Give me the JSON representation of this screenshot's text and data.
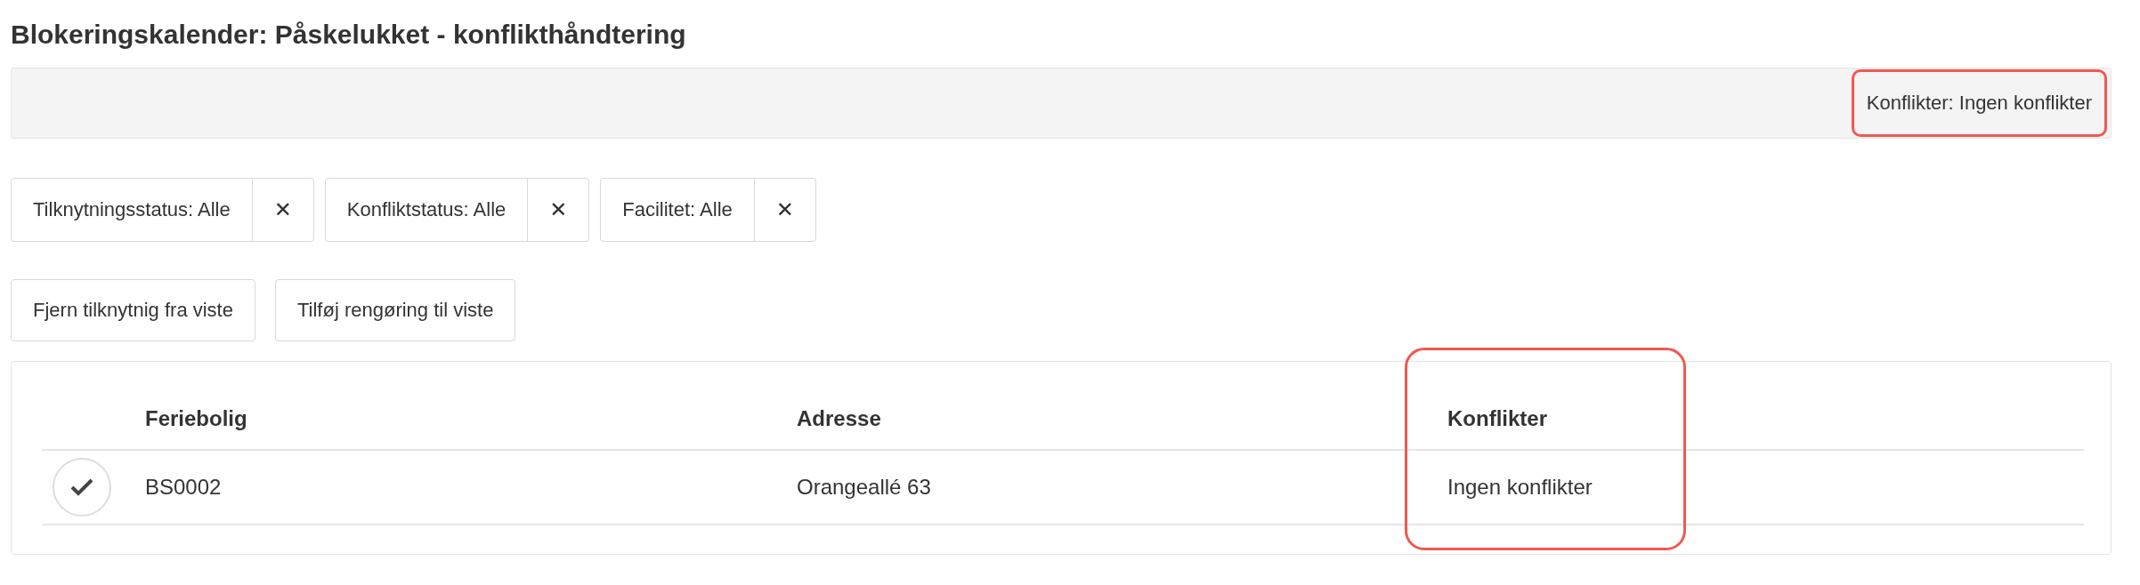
{
  "title": "Blokeringskalender: Påskelukket - konflikthåndtering",
  "summary_bar": {
    "text": "Konflikter: Ingen konflikter",
    "highlighted": true
  },
  "filters": [
    {
      "label": "Tilknytningsstatus: Alle",
      "remove": "✕"
    },
    {
      "label": "Konfliktstatus: Alle",
      "remove": "✕"
    },
    {
      "label": "Facilitet: Alle",
      "remove": "✕"
    }
  ],
  "buttons": [
    "Fjern tilknytnig fra viste",
    "Tilføj rengøring til viste"
  ],
  "table": {
    "columns": [
      {
        "label": "Feriebolig",
        "highlighted": false
      },
      {
        "label": "Adresse",
        "highlighted": false
      },
      {
        "label": "Konflikter",
        "highlighted": true
      }
    ],
    "rows": [
      {
        "selected": true,
        "cells": [
          "BS0002",
          "Orangeallé 63",
          "Ingen konflikter"
        ]
      }
    ]
  }
}
